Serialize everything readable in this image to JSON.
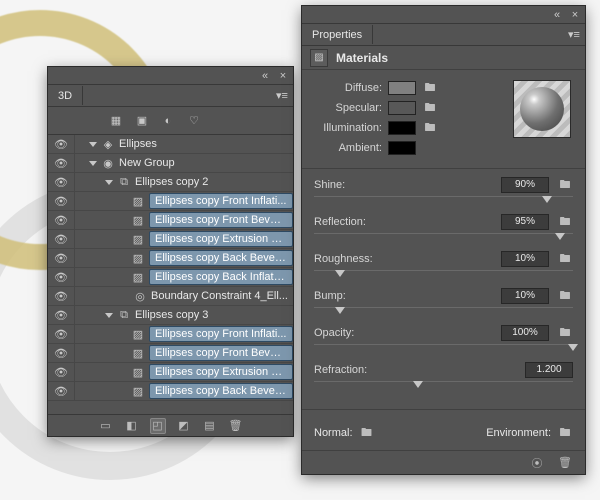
{
  "panel3d": {
    "tab": "3D",
    "tools": [
      "grid-icon",
      "render-icon",
      "camera-icon",
      "light-icon"
    ],
    "tree": [
      {
        "indent": 0,
        "arrow": true,
        "icon": "scene",
        "label": "Ellipses",
        "sel": false
      },
      {
        "indent": 0,
        "arrow": true,
        "icon": "sphere",
        "label": "New Group",
        "sel": false
      },
      {
        "indent": 1,
        "arrow": true,
        "icon": "mesh",
        "label": "Ellipses copy 2",
        "sel": false
      },
      {
        "indent": 2,
        "arrow": false,
        "icon": "mat",
        "label": "Ellipses copy Front Inflati...",
        "sel": true
      },
      {
        "indent": 2,
        "arrow": false,
        "icon": "mat",
        "label": "Ellipses copy Front Bevel ...",
        "sel": true
      },
      {
        "indent": 2,
        "arrow": false,
        "icon": "mat",
        "label": "Ellipses copy Extrusion M...",
        "sel": true
      },
      {
        "indent": 2,
        "arrow": false,
        "icon": "mat",
        "label": "Ellipses copy Back Bevel ...",
        "sel": true
      },
      {
        "indent": 2,
        "arrow": false,
        "icon": "mat",
        "label": "Ellipses copy Back Inflatio...",
        "sel": true
      },
      {
        "indent": 2,
        "arrow": false,
        "icon": "con",
        "label": "Boundary Constraint 4_Ell...",
        "sel": false
      },
      {
        "indent": 1,
        "arrow": true,
        "icon": "mesh",
        "label": "Ellipses copy 3",
        "sel": false
      },
      {
        "indent": 2,
        "arrow": false,
        "icon": "mat",
        "label": "Ellipses copy Front Inflati...",
        "sel": true
      },
      {
        "indent": 2,
        "arrow": false,
        "icon": "mat",
        "label": "Ellipses copy Front Bevel ...",
        "sel": true
      },
      {
        "indent": 2,
        "arrow": false,
        "icon": "mat",
        "label": "Ellipses copy Extrusion M...",
        "sel": true
      },
      {
        "indent": 2,
        "arrow": false,
        "icon": "mat",
        "label": "Ellipses copy Back Bevel ...",
        "sel": true
      }
    ]
  },
  "props": {
    "tab": "Properties",
    "section": "Materials",
    "labels": {
      "diffuse": "Diffuse:",
      "specular": "Specular:",
      "illumination": "Illumination:",
      "ambient": "Ambient:",
      "shine": "Shine:",
      "reflection": "Reflection:",
      "roughness": "Roughness:",
      "bump": "Bump:",
      "opacity": "Opacity:",
      "refraction": "Refraction:",
      "normal": "Normal:",
      "environment": "Environment:"
    },
    "values": {
      "shine": "90%",
      "reflection": "95%",
      "roughness": "10%",
      "bump": "10%",
      "opacity": "100%",
      "refraction": "1.200"
    },
    "slider_pos": {
      "shine": 90,
      "reflection": 95,
      "roughness": 10,
      "bump": 10,
      "opacity": 100,
      "refraction": 40
    }
  }
}
